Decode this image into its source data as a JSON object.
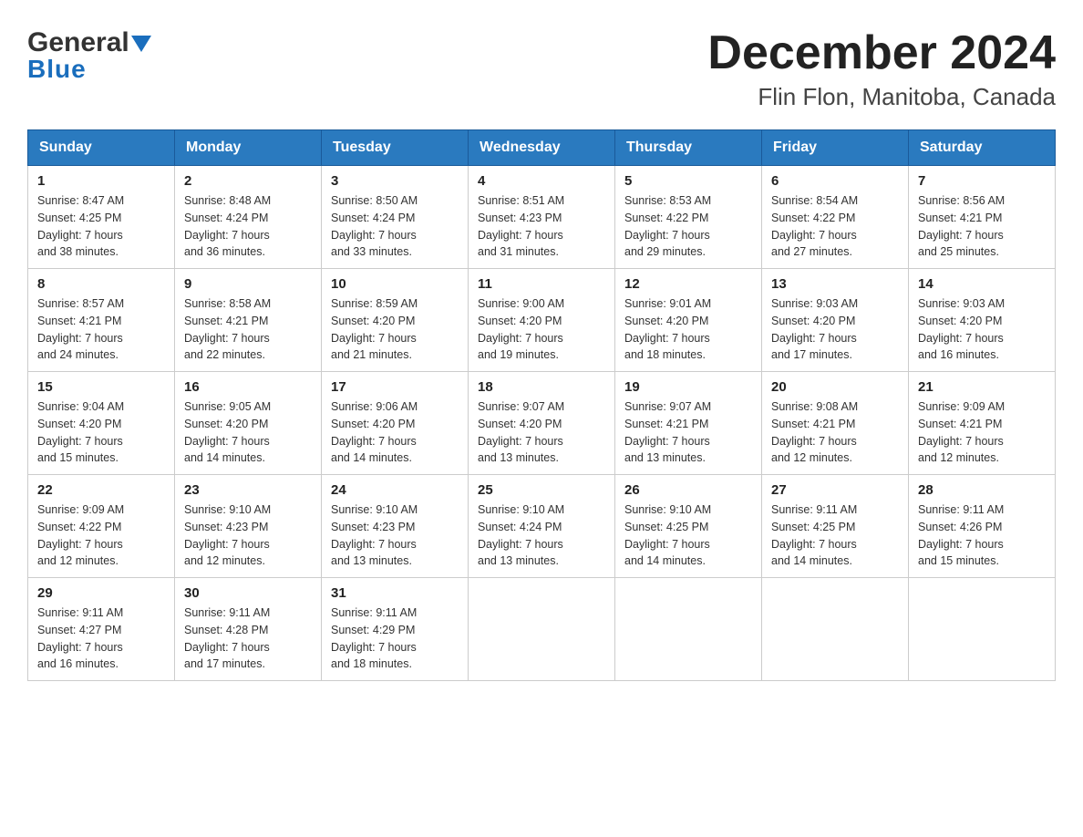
{
  "header": {
    "logo_general": "General",
    "logo_blue": "Blue",
    "title": "December 2024",
    "subtitle": "Flin Flon, Manitoba, Canada"
  },
  "days_of_week": [
    "Sunday",
    "Monday",
    "Tuesday",
    "Wednesday",
    "Thursday",
    "Friday",
    "Saturday"
  ],
  "weeks": [
    [
      {
        "day": "1",
        "sunrise": "8:47 AM",
        "sunset": "4:25 PM",
        "daylight": "7 hours and 38 minutes."
      },
      {
        "day": "2",
        "sunrise": "8:48 AM",
        "sunset": "4:24 PM",
        "daylight": "7 hours and 36 minutes."
      },
      {
        "day": "3",
        "sunrise": "8:50 AM",
        "sunset": "4:24 PM",
        "daylight": "7 hours and 33 minutes."
      },
      {
        "day": "4",
        "sunrise": "8:51 AM",
        "sunset": "4:23 PM",
        "daylight": "7 hours and 31 minutes."
      },
      {
        "day": "5",
        "sunrise": "8:53 AM",
        "sunset": "4:22 PM",
        "daylight": "7 hours and 29 minutes."
      },
      {
        "day": "6",
        "sunrise": "8:54 AM",
        "sunset": "4:22 PM",
        "daylight": "7 hours and 27 minutes."
      },
      {
        "day": "7",
        "sunrise": "8:56 AM",
        "sunset": "4:21 PM",
        "daylight": "7 hours and 25 minutes."
      }
    ],
    [
      {
        "day": "8",
        "sunrise": "8:57 AM",
        "sunset": "4:21 PM",
        "daylight": "7 hours and 24 minutes."
      },
      {
        "day": "9",
        "sunrise": "8:58 AM",
        "sunset": "4:21 PM",
        "daylight": "7 hours and 22 minutes."
      },
      {
        "day": "10",
        "sunrise": "8:59 AM",
        "sunset": "4:20 PM",
        "daylight": "7 hours and 21 minutes."
      },
      {
        "day": "11",
        "sunrise": "9:00 AM",
        "sunset": "4:20 PM",
        "daylight": "7 hours and 19 minutes."
      },
      {
        "day": "12",
        "sunrise": "9:01 AM",
        "sunset": "4:20 PM",
        "daylight": "7 hours and 18 minutes."
      },
      {
        "day": "13",
        "sunrise": "9:03 AM",
        "sunset": "4:20 PM",
        "daylight": "7 hours and 17 minutes."
      },
      {
        "day": "14",
        "sunrise": "9:03 AM",
        "sunset": "4:20 PM",
        "daylight": "7 hours and 16 minutes."
      }
    ],
    [
      {
        "day": "15",
        "sunrise": "9:04 AM",
        "sunset": "4:20 PM",
        "daylight": "7 hours and 15 minutes."
      },
      {
        "day": "16",
        "sunrise": "9:05 AM",
        "sunset": "4:20 PM",
        "daylight": "7 hours and 14 minutes."
      },
      {
        "day": "17",
        "sunrise": "9:06 AM",
        "sunset": "4:20 PM",
        "daylight": "7 hours and 14 minutes."
      },
      {
        "day": "18",
        "sunrise": "9:07 AM",
        "sunset": "4:20 PM",
        "daylight": "7 hours and 13 minutes."
      },
      {
        "day": "19",
        "sunrise": "9:07 AM",
        "sunset": "4:21 PM",
        "daylight": "7 hours and 13 minutes."
      },
      {
        "day": "20",
        "sunrise": "9:08 AM",
        "sunset": "4:21 PM",
        "daylight": "7 hours and 12 minutes."
      },
      {
        "day": "21",
        "sunrise": "9:09 AM",
        "sunset": "4:21 PM",
        "daylight": "7 hours and 12 minutes."
      }
    ],
    [
      {
        "day": "22",
        "sunrise": "9:09 AM",
        "sunset": "4:22 PM",
        "daylight": "7 hours and 12 minutes."
      },
      {
        "day": "23",
        "sunrise": "9:10 AM",
        "sunset": "4:23 PM",
        "daylight": "7 hours and 12 minutes."
      },
      {
        "day": "24",
        "sunrise": "9:10 AM",
        "sunset": "4:23 PM",
        "daylight": "7 hours and 13 minutes."
      },
      {
        "day": "25",
        "sunrise": "9:10 AM",
        "sunset": "4:24 PM",
        "daylight": "7 hours and 13 minutes."
      },
      {
        "day": "26",
        "sunrise": "9:10 AM",
        "sunset": "4:25 PM",
        "daylight": "7 hours and 14 minutes."
      },
      {
        "day": "27",
        "sunrise": "9:11 AM",
        "sunset": "4:25 PM",
        "daylight": "7 hours and 14 minutes."
      },
      {
        "day": "28",
        "sunrise": "9:11 AM",
        "sunset": "4:26 PM",
        "daylight": "7 hours and 15 minutes."
      }
    ],
    [
      {
        "day": "29",
        "sunrise": "9:11 AM",
        "sunset": "4:27 PM",
        "daylight": "7 hours and 16 minutes."
      },
      {
        "day": "30",
        "sunrise": "9:11 AM",
        "sunset": "4:28 PM",
        "daylight": "7 hours and 17 minutes."
      },
      {
        "day": "31",
        "sunrise": "9:11 AM",
        "sunset": "4:29 PM",
        "daylight": "7 hours and 18 minutes."
      },
      null,
      null,
      null,
      null
    ]
  ],
  "labels": {
    "sunrise": "Sunrise:",
    "sunset": "Sunset:",
    "daylight": "Daylight:"
  }
}
